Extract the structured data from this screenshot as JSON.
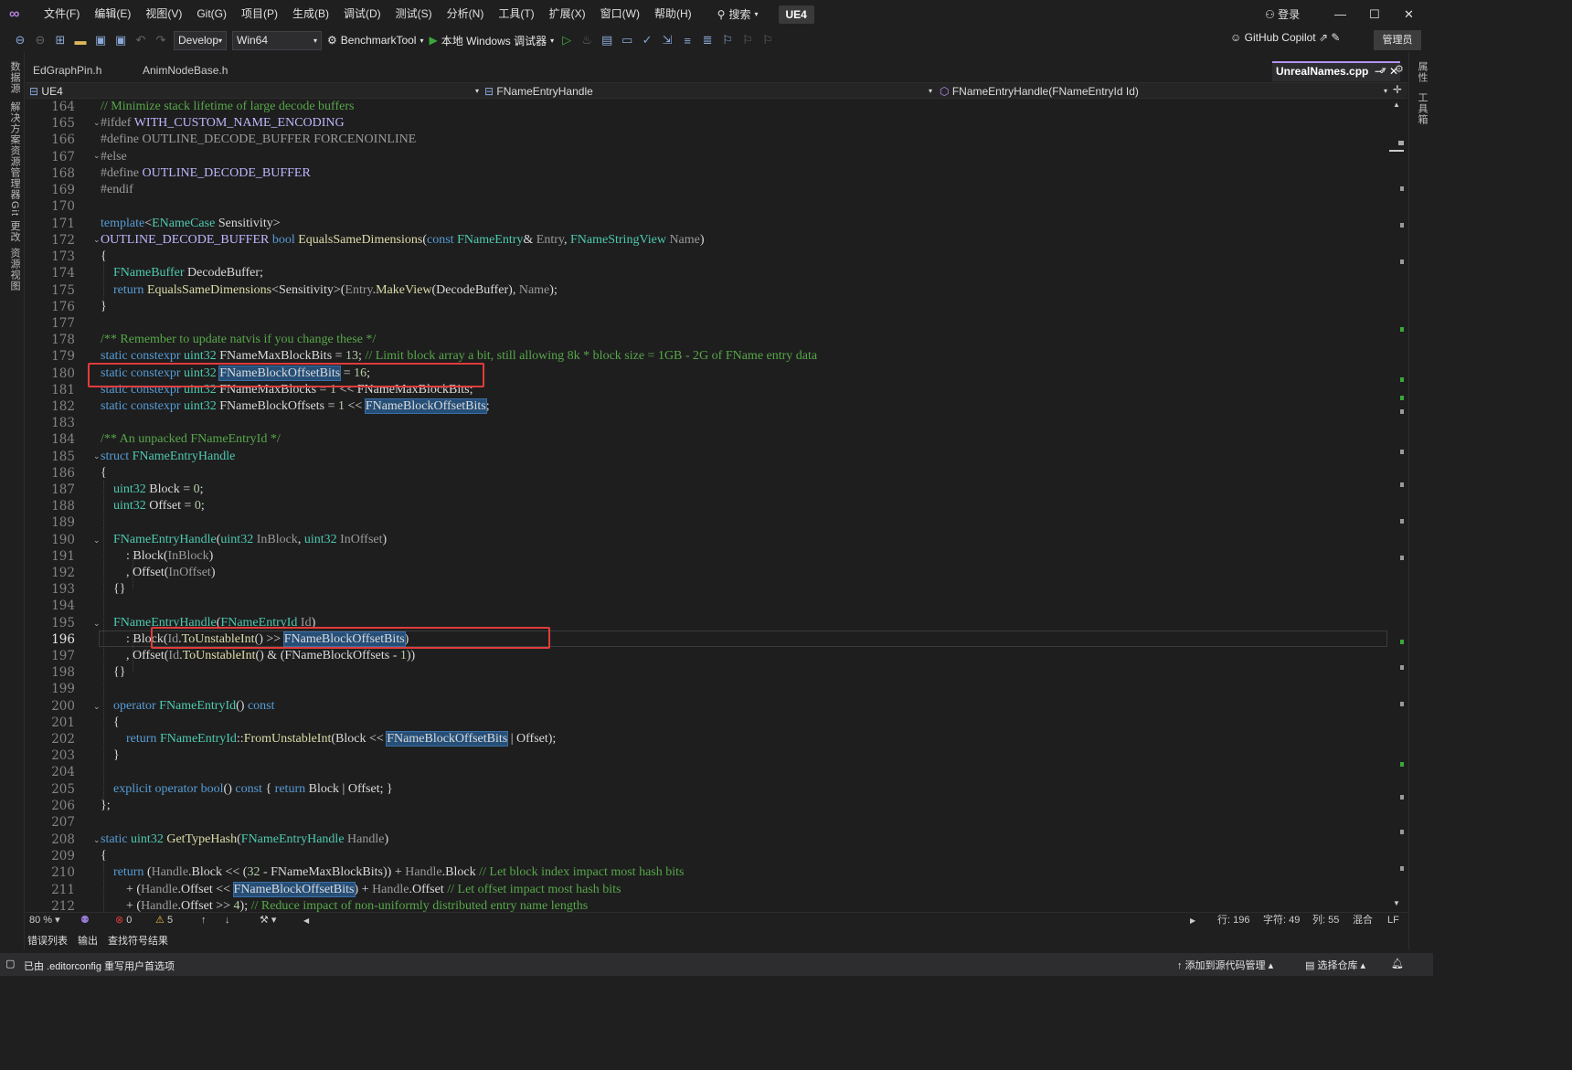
{
  "menubar": {
    "logo_icon": "visual-studio-logo",
    "items": [
      "文件(F)",
      "编辑(E)",
      "视图(V)",
      "Git(G)",
      "项目(P)",
      "生成(B)",
      "调试(D)",
      "测试(S)",
      "分析(N)",
      "工具(T)",
      "扩展(X)",
      "窗口(W)",
      "帮助(H)"
    ],
    "search_label": "搜索",
    "solution_name": "UE4",
    "login_label": "登录"
  },
  "toolbar": {
    "config": "Develop",
    "platform": "Win64",
    "startup_project": "BenchmarkTool",
    "debugger": "本地 Windows 调试器",
    "copilot_label": "GitHub Copilot",
    "admin_label": "管理员"
  },
  "left_panel_tabs": [
    "数据源",
    "解决方案资源管理器",
    "Git 更改",
    "资源视图"
  ],
  "right_panel_tabs": [
    "属性",
    "工具箱"
  ],
  "doc_tabs": {
    "inactive": [
      "EdGraphPin.h",
      "AnimNodeBase.h"
    ],
    "active": "UnrealNames.cpp"
  },
  "navbar": {
    "project": "UE4",
    "scope": "FNameEntryHandle",
    "member": "FNameEntryHandle(FNameEntryId Id)"
  },
  "editor": {
    "line_numbers": [
      "164",
      "165",
      "166",
      "167",
      "168",
      "169",
      "170",
      "171",
      "172",
      "173",
      "174",
      "175",
      "176",
      "177",
      "178",
      "179",
      "180",
      "181",
      "182",
      "183",
      "184",
      "185",
      "186",
      "187",
      "188",
      "189",
      "190",
      "191",
      "192",
      "193",
      "194",
      "195",
      "196",
      "197",
      "198",
      "199",
      "200",
      "201",
      "202",
      "203",
      "204",
      "205",
      "206",
      "207",
      "208",
      "209",
      "210",
      "211",
      "212"
    ],
    "current_line": "196"
  },
  "status_row": {
    "zoom": "80 %",
    "errors": "0",
    "warnings": "5",
    "line": "行: 196",
    "char": "字符: 49",
    "col": "列: 55",
    "whitespace": "混合",
    "eol": "LF"
  },
  "bottom_tabs": [
    "错误列表",
    "输出",
    "查找符号结果"
  ],
  "statusbar": {
    "message": "已由 .editorconfig 重写用户首选项",
    "source_control": "添加到源代码管理",
    "repository": "选择仓库"
  },
  "colors": {
    "keyword": "#569cd6",
    "type": "#4ec9b0",
    "comment": "#57a64a",
    "highlight": "#264f78",
    "red_box": "#e03c3c",
    "active_tab_accent": "#b392f0"
  }
}
